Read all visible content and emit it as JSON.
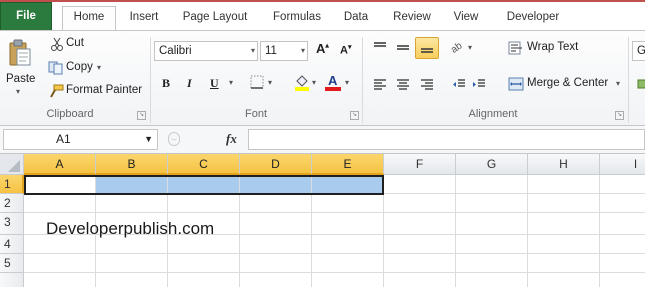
{
  "tabs": [
    {
      "id": "file",
      "label": "File"
    },
    {
      "id": "home",
      "label": "Home"
    },
    {
      "id": "insert",
      "label": "Insert"
    },
    {
      "id": "pagelayout",
      "label": "Page Layout"
    },
    {
      "id": "formulas",
      "label": "Formulas"
    },
    {
      "id": "data",
      "label": "Data"
    },
    {
      "id": "review",
      "label": "Review"
    },
    {
      "id": "view",
      "label": "View"
    },
    {
      "id": "developer",
      "label": "Developer"
    }
  ],
  "clipboard": {
    "paste": "Paste",
    "cut": "Cut",
    "copy": "Copy",
    "format_painter": "Format Painter",
    "group": "Clipboard"
  },
  "font": {
    "name": "Calibri",
    "size": "11",
    "bold": "B",
    "italic": "I",
    "underline": "U",
    "font_color_glyph": "A",
    "grow_glyph": "A",
    "shrink_glyph": "A",
    "group": "Font"
  },
  "alignment": {
    "wrap_text": "Wrap Text",
    "merge_center": "Merge & Center",
    "group": "Alignment"
  },
  "number": {
    "format_partial": "G"
  },
  "formula_bar": {
    "name_box": "A1",
    "fx": "fx",
    "value": ""
  },
  "grid": {
    "columns": [
      "A",
      "B",
      "C",
      "D",
      "E",
      "F",
      "G",
      "H",
      "I"
    ],
    "rows": [
      "1",
      "2",
      "3",
      "4",
      "5"
    ],
    "selected_range": "A1:E1",
    "cell_a3": "Developerpublish.com"
  },
  "colors": {
    "file_tab": "#2b7a3e",
    "selection_header": "#f5c243",
    "selection_fill": "#a9cbed",
    "font_color_bar": "#e31a1c",
    "highlight_bar": "#ffff00"
  }
}
